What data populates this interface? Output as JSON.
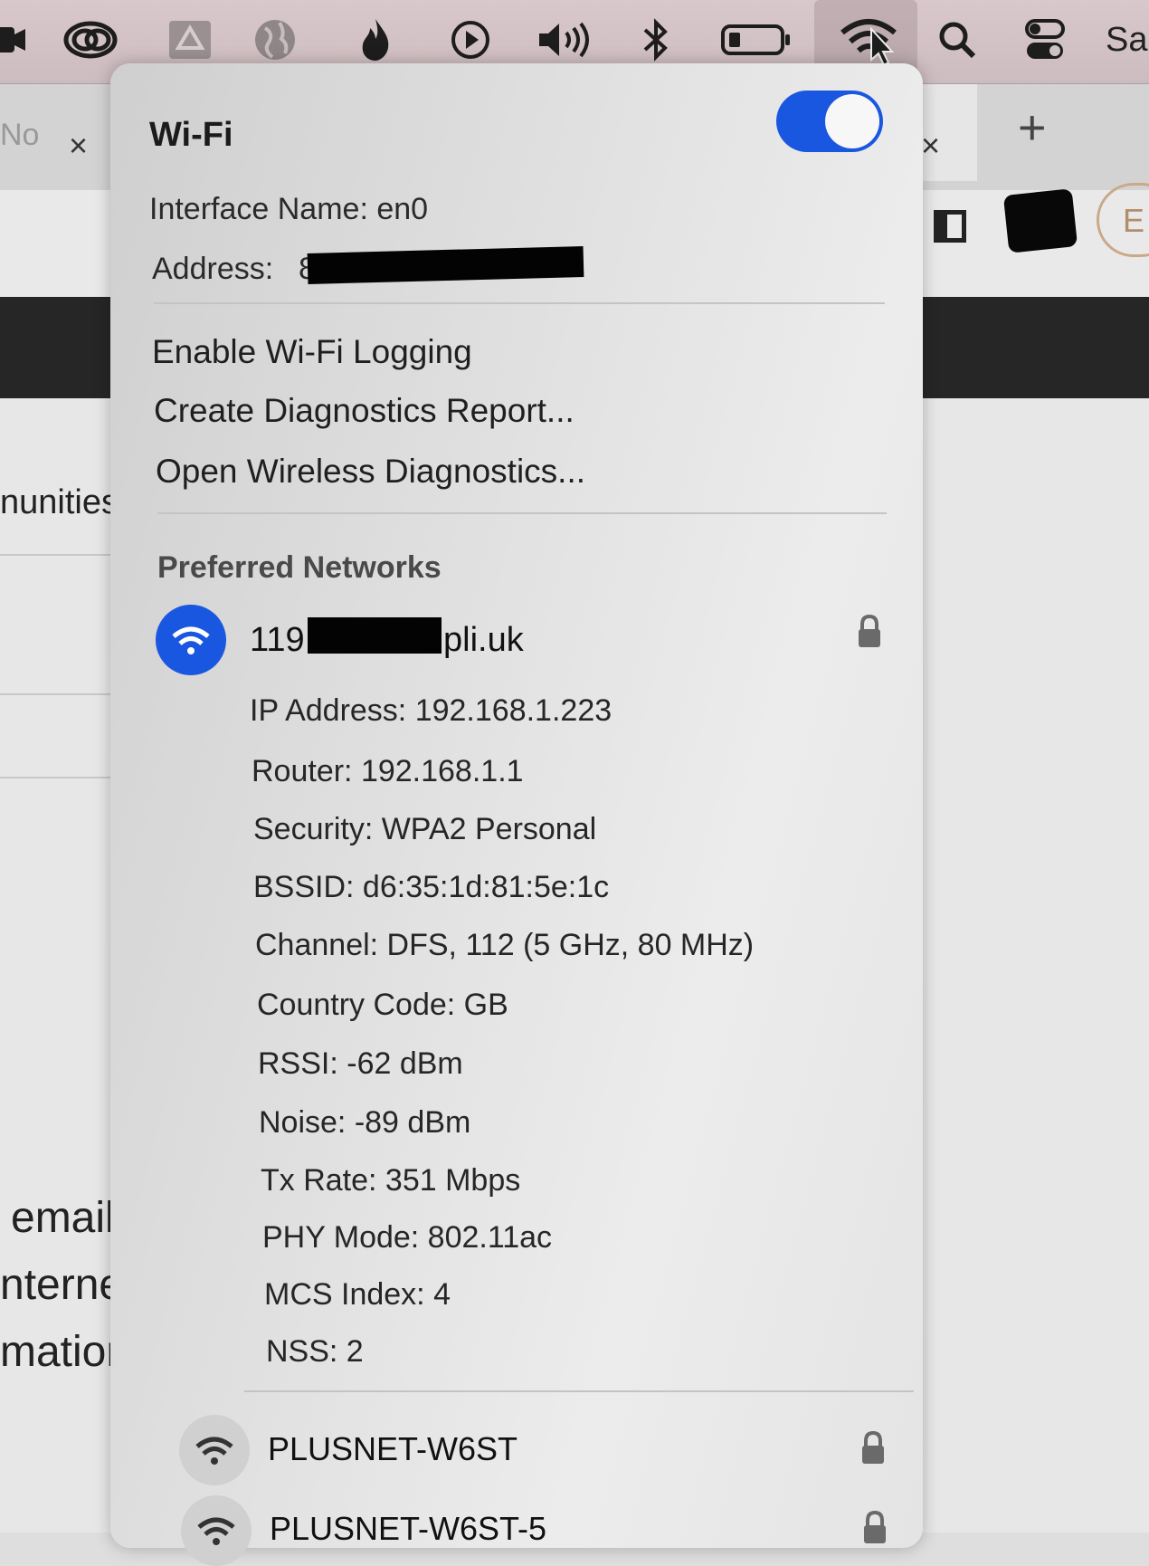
{
  "menubar": {
    "icons": [
      "zoom-icon",
      "creative-cloud-icon",
      "drive-icon",
      "globe-icon",
      "flame-icon",
      "play-icon",
      "volume-icon",
      "bluetooth-icon",
      "battery-icon",
      "wifi-icon",
      "search-icon",
      "control-center-icon"
    ],
    "clock_text": "Sa"
  },
  "background": {
    "tab_partial": "No",
    "tab_close": "×",
    "tab_close_right": "×",
    "new_tab": "+",
    "pill_text": "E",
    "text_1": "nunities",
    "text_2": "email,",
    "text_3": "nternet",
    "text_4": "mation"
  },
  "wifi_panel": {
    "title": "Wi-Fi",
    "enabled": true,
    "interface_name": "Interface Name: en0",
    "address_label": "Address:",
    "address_value_prefix": "8",
    "menu_items": [
      "Enable Wi-Fi Logging",
      "Create Diagnostics Report...",
      "Open Wireless Diagnostics..."
    ],
    "preferred_header": "Preferred Networks",
    "current_network": {
      "name_prefix": "119",
      "name_suffix": "pli.uk",
      "details": [
        "IP Address: 192.168.1.223",
        "Router: 192.168.1.1",
        "Security: WPA2 Personal",
        "BSSID: d6:35:1d:81:5e:1c",
        "Channel: DFS, 112 (5 GHz, 80 MHz)",
        "Country Code: GB",
        "RSSI: -62 dBm",
        "Noise: -89 dBm",
        "Tx Rate: 351 Mbps",
        "PHY Mode: 802.11ac",
        "MCS Index: 4",
        "NSS: 2"
      ]
    },
    "other_networks": [
      "PLUSNET-W6ST",
      "PLUSNET-W6ST-5"
    ]
  },
  "colors": {
    "accent": "#1a57e0",
    "menubar": "#d6c5c8"
  }
}
